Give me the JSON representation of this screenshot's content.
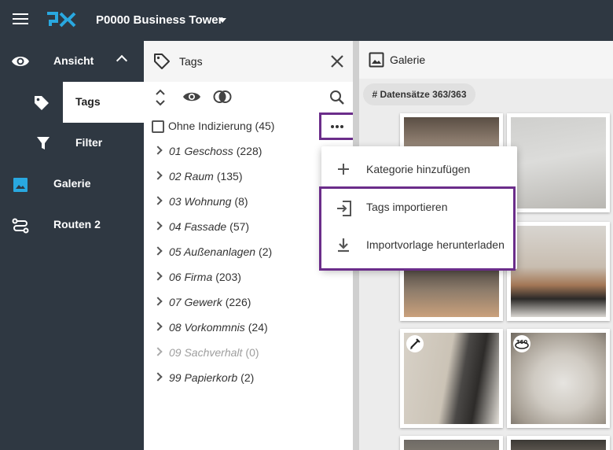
{
  "header": {
    "project_name": "P0000 Business Tower",
    "logo": "px-logo"
  },
  "sidebar": {
    "items": [
      {
        "label": "Ansicht",
        "icon": "eye-icon"
      },
      {
        "label": "Tags",
        "icon": "tag-icon"
      },
      {
        "label": "Filter",
        "icon": "filter-icon"
      },
      {
        "label": "Galerie",
        "icon": "image-icon"
      },
      {
        "label": "Routen 2",
        "icon": "route-icon"
      }
    ]
  },
  "tags_panel": {
    "title": "Tags",
    "untagged": {
      "label": "Ohne Indizierung",
      "count": "(45)"
    },
    "tags": [
      {
        "name": "01 Geschoss",
        "count": "(228)"
      },
      {
        "name": "02 Raum",
        "count": "(135)"
      },
      {
        "name": "03 Wohnung",
        "count": "(8)"
      },
      {
        "name": "04 Fassade",
        "count": "(57)"
      },
      {
        "name": "05 Außenanlagen",
        "count": "(2)"
      },
      {
        "name": "06 Firma",
        "count": "(203)"
      },
      {
        "name": "07 Gewerk",
        "count": "(226)"
      },
      {
        "name": "08 Vorkommnis",
        "count": "(24)"
      },
      {
        "name": "09 Sachverhalt",
        "count": "(0)",
        "disabled": true
      },
      {
        "name": "99 Papierkorb",
        "count": "(2)"
      }
    ]
  },
  "gallery": {
    "title": "Galerie",
    "records_chip": "# Datensätze 363/363"
  },
  "context_menu": {
    "items": [
      {
        "label": "Kategorie hinzufügen",
        "icon": "plus-icon"
      },
      {
        "label": "Tags importieren",
        "icon": "import-icon"
      },
      {
        "label": "Importvorlage herunterladen",
        "icon": "download-icon"
      }
    ]
  },
  "colors": {
    "header_bg": "#2f3842",
    "accent_blue": "#29a8e0",
    "highlight_purple": "#6b2d8a"
  }
}
